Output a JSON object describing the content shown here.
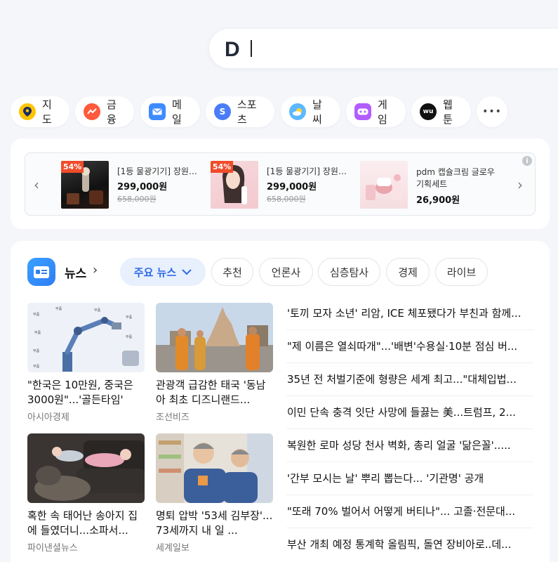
{
  "search": {
    "logo": "D"
  },
  "quick_links": [
    {
      "label": "지도",
      "icon": "map-pin-icon",
      "color": "#ffc400"
    },
    {
      "label": "금융",
      "icon": "finance-chart-icon",
      "color": "#ff5a3c"
    },
    {
      "label": "메일",
      "icon": "mail-icon",
      "color": "#3d8bff"
    },
    {
      "label": "스포츠",
      "icon": "sports-icon",
      "color": "#4a7cf7"
    },
    {
      "label": "날씨",
      "icon": "weather-icon",
      "color": "#5cb8ff"
    },
    {
      "label": "게임",
      "icon": "game-icon",
      "color": "#b25dff"
    },
    {
      "label": "웹툰",
      "icon": "webtoon-icon",
      "color": "#111111"
    }
  ],
  "more_label": "•••",
  "shopping": {
    "info_label": "i",
    "products": [
      {
        "badge": "54%",
        "name": "[1등 물광기기] 장원영...",
        "price": "299,000원",
        "original_price": "658,000원"
      },
      {
        "badge": "54%",
        "name": "[1등 물광기기] 장원영...",
        "price": "299,000원",
        "original_price": "658,000원"
      },
      {
        "badge": "",
        "name": "pdm 캡슐크림 글로우 기획세트",
        "price": "26,900원",
        "original_price": ""
      }
    ]
  },
  "news": {
    "title": "뉴스",
    "tabs": [
      "주요 뉴스",
      "추천",
      "언론사",
      "심층탐사",
      "경제",
      "라이브"
    ],
    "thumb_articles": [
      {
        "title": "\"한국은 10만원, 중국은 3000원\"...'골든타임' 놓...",
        "source": "아시아경제"
      },
      {
        "title": "관광객 급감한 태국 '동남아 최초 디즈니랜드...",
        "source": "조선비즈"
      },
      {
        "title": "혹한 속 태어난 송아지 집에 들였더니...소파서...",
        "source": "파이낸셜뉴스"
      },
      {
        "title": "명퇴 압박 '53세 김부장'... 73세까지 내 일 ...",
        "source": "세계일보"
      }
    ],
    "headlines": [
      "'토끼 모자 소년' 리암, ICE 체포됐다가 부친과 함께...",
      "\"제 이름은 열쇠따개\"...'배변'수용실·10분 점심 버...",
      "35년 전 처벌기준에 형량은 세계 최고...\"대체입법...",
      "이민 단속 충격 잇단 사망에 들끓는 美...트럼프, 2...",
      "복원한 로마 성당 천사 벽화, 총리 얼굴 '닮은꼴'.....",
      "'간부 모시는 날' 뿌리 뽑는다... '기관명' 공개",
      "\"또래 70% 벌어서 어떻게 버티나\"... 고졸·전문대...",
      "부산 개최 예정 통계학 올림픽, 돌연 장비아로..데..."
    ]
  }
}
